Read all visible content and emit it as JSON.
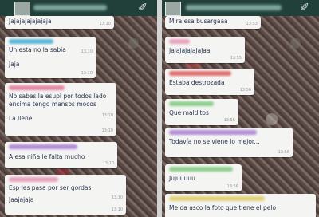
{
  "icons": {
    "attach_glyph": "✐"
  },
  "left_screen": {
    "messages": [
      {
        "text": "Jajajajajajajaja",
        "time": "13:10"
      },
      {
        "text": "Uh esta no la sabia",
        "time": "13:10",
        "sender_color": "#5bb7d9"
      },
      {
        "text": "Jaja",
        "time": "13:10"
      },
      {
        "text": "No sabes la esupi por todos lado",
        "time": "",
        "sender_color": "#e48aa6"
      },
      {
        "text": "encima tengo mansos mocos",
        "time": "13:10"
      },
      {
        "text": "La llene",
        "time": "13:10"
      },
      {
        "text": "A esa niña le falta mucho",
        "time": "13:10",
        "sender_color": "#b48fd6"
      },
      {
        "text": "Esp les pasa por ser gordas",
        "time": "13:10",
        "sender_color": "#e9a2be"
      },
      {
        "text": "Jaajajaja",
        "time": "13:10"
      }
    ]
  },
  "right_screen": {
    "messages": [
      {
        "text": "Mira esa busargaaa",
        "time": "13:53"
      },
      {
        "text": "Jajajajajajajaa",
        "time": "13:55",
        "sender_color": "#e9a2be"
      },
      {
        "text": "Estaba destrozada",
        "time": "13:56",
        "sender_color": "#e07070"
      },
      {
        "text": "Que malditos",
        "time": "13:56",
        "sender_color": "#8fcf8f"
      },
      {
        "text": "Todavía no se viene lo mejor...",
        "time": "13:56",
        "sender_color": "#b48fd6"
      },
      {
        "text": "Jujuuuuu",
        "time": "13:56",
        "sender_color": "#8fcf8f"
      },
      {
        "text": "Me da asco la foto que tiene el pelo",
        "time": "",
        "sender_color": "#e2d27a"
      }
    ]
  }
}
